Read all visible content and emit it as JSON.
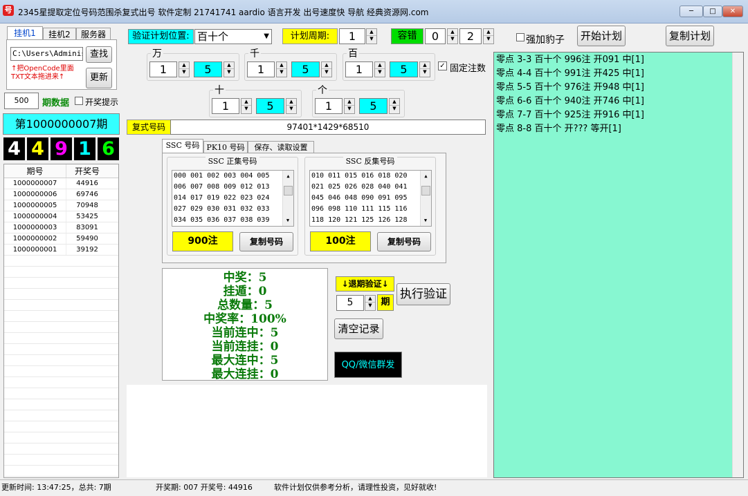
{
  "window": {
    "title": "2345星提取定位号码范围杀复式出号 软件定制 21741741 aardio 语言开发 出号速度快 导航 经典资源网.com",
    "icon_glyph": "号",
    "min": "─",
    "max": "□",
    "close": "✕"
  },
  "left_tabs": [
    "挂机1",
    "挂机2",
    "服务器"
  ],
  "path_input": "C:\\Users\\Administ",
  "browse_button": "查找",
  "hint_lines": [
    "↑把OpenCode里面",
    "TXT文本拖进来↑"
  ],
  "update_button": "更新",
  "period_count": "500",
  "period_data_label": "期数据",
  "lottery_notice_label": "开奖提示",
  "current_period": "第1000000007期",
  "digits": [
    {
      "value": "4",
      "color": "#ffffff"
    },
    {
      "value": "4",
      "color": "#ffff00"
    },
    {
      "value": "9",
      "color": "#ff00ff"
    },
    {
      "value": "1",
      "color": "#00ffff"
    },
    {
      "value": "6",
      "color": "#00ff00"
    }
  ],
  "history": {
    "headers": [
      "期号",
      "开奖号"
    ],
    "rows": [
      [
        "1000000007",
        "44916"
      ],
      [
        "1000000006",
        "69746"
      ],
      [
        "1000000005",
        "70948"
      ],
      [
        "1000000004",
        "53425"
      ],
      [
        "1000000003",
        "83091"
      ],
      [
        "1000000002",
        "59490"
      ],
      [
        "1000000001",
        "39192"
      ]
    ]
  },
  "verify_position_label": "验证计划位置:",
  "verify_position_value": "百十个",
  "plan_cycle_label": "计划周期:",
  "plan_cycle_value": "1",
  "tolerance_label": "容错",
  "tolerance_min": "0",
  "tolerance_max": "2",
  "force_leopard_label": "强加豹子",
  "start_plan_button": "开始计划",
  "copy_plan_button": "复制计划",
  "positions": [
    {
      "label": "万",
      "a": "1",
      "b": "5"
    },
    {
      "label": "千",
      "a": "1",
      "b": "5"
    },
    {
      "label": "百",
      "a": "1",
      "b": "5"
    },
    {
      "label": "十",
      "a": "1",
      "b": "5"
    },
    {
      "label": "个",
      "a": "1",
      "b": "5"
    }
  ],
  "fixed_bets_label": "固定注数",
  "compound_label": "复式号码",
  "compound_value": "97401*1429*68510",
  "content_tabs": [
    "SSC 号码",
    "PK10 号码",
    "保存、读取设置"
  ],
  "positive_set": {
    "title": "SSC 正集号码",
    "lines": [
      "000 001 002 003 004 005",
      "006 007 008 009 012 013",
      "014 017 019 022 023 024",
      "027 029 030 031 032 033",
      "034 035 036 037 038 039"
    ],
    "count": "900注",
    "copy": "复制号码"
  },
  "negative_set": {
    "title": "SSC 反集号码",
    "lines": [
      "010 011 015 016 018 020",
      "021 025 026 028 040 041",
      "045 046 048 090 091 095",
      "096 098 110 111 115 116",
      "118 120 121 125 126 128"
    ],
    "count": "100注",
    "copy": "复制号码"
  },
  "stats": [
    "中奖：5",
    "挂遁：0",
    "总数量：5",
    "中奖率：100%",
    "当前连中：5",
    "当前连挂：0",
    "最大连中：5",
    "最大连挂：0"
  ],
  "backtest_label": "↓退期验证↓",
  "backtest_value": "5",
  "backtest_unit": "期",
  "execute_button": "执行验证",
  "clear_button": "清空记录",
  "qq_button": "QQ/微信群发",
  "log_lines": [
    "零点 3-3 百十个 996注 开091 中[1]",
    "零点 4-4 百十个 991注 开425 中[1]",
    "零点 5-5 百十个 976注 开948 中[1]",
    "零点 6-6 百十个 940注 开746 中[1]",
    "零点 7-7 百十个 925注 开916 中[1]",
    "零点 8-8 百十个 开???  等开[1]"
  ],
  "status": {
    "update_time": "更新时间: 13:47:25，总共: 7期",
    "draw": "开奖期: 007 开奖号: 44916",
    "disclaimer": "软件计划仅供参考分析，请理性投资，见好就收!"
  }
}
